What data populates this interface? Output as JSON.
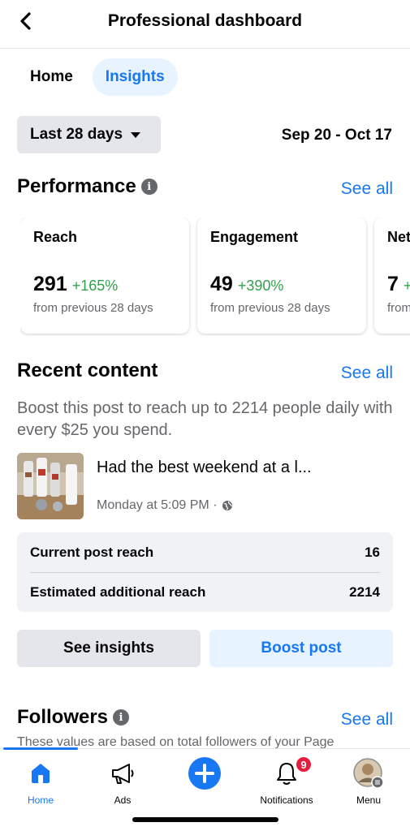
{
  "header": {
    "title": "Professional dashboard",
    "back_icon": "chevron-left-icon"
  },
  "tabs": [
    {
      "label": "Home",
      "active": false
    },
    {
      "label": "Insights",
      "active": true
    }
  ],
  "date_filter": {
    "selected": "Last 28 days",
    "range": "Sep 20 - Oct 17"
  },
  "performance": {
    "title": "Performance",
    "see_all": "See all",
    "cards": [
      {
        "label": "Reach",
        "value": "291",
        "delta": "+165%",
        "sub": "from previous 28 days"
      },
      {
        "label": "Engagement",
        "value": "49",
        "delta": "+390%",
        "sub": "from previous 28 days"
      },
      {
        "label": "Net",
        "value": "7",
        "delta": "+",
        "sub": "from"
      }
    ]
  },
  "recent_content": {
    "title": "Recent content",
    "see_all": "See all",
    "boost_text": "Boost this post to reach up to 2214 people daily with every $25 you spend.",
    "post": {
      "title": "Had the best weekend at a l...",
      "meta": "Monday at 5:09 PM ·",
      "privacy_icon": "globe-icon"
    },
    "reach": [
      {
        "label": "Current post reach",
        "value": "16"
      },
      {
        "label": "Estimated additional reach",
        "value": "2214"
      }
    ],
    "see_insights": "See insights",
    "boost_post": "Boost post"
  },
  "followers": {
    "title": "Followers",
    "see_all": "See all",
    "note": "These values are based on total followers of your Page"
  },
  "bottom_nav": [
    {
      "label": "Home",
      "icon": "home-icon",
      "active": true
    },
    {
      "label": "Ads",
      "icon": "megaphone-icon",
      "active": false
    },
    {
      "label": "",
      "icon": "plus-icon",
      "active": false
    },
    {
      "label": "Notifications",
      "icon": "bell-icon",
      "badge": "9",
      "active": false
    },
    {
      "label": "Menu",
      "icon": "avatar-icon",
      "active": false
    }
  ],
  "colors": {
    "accent": "#1877f2",
    "positive": "#31a24c",
    "badge": "#e41e3f"
  }
}
